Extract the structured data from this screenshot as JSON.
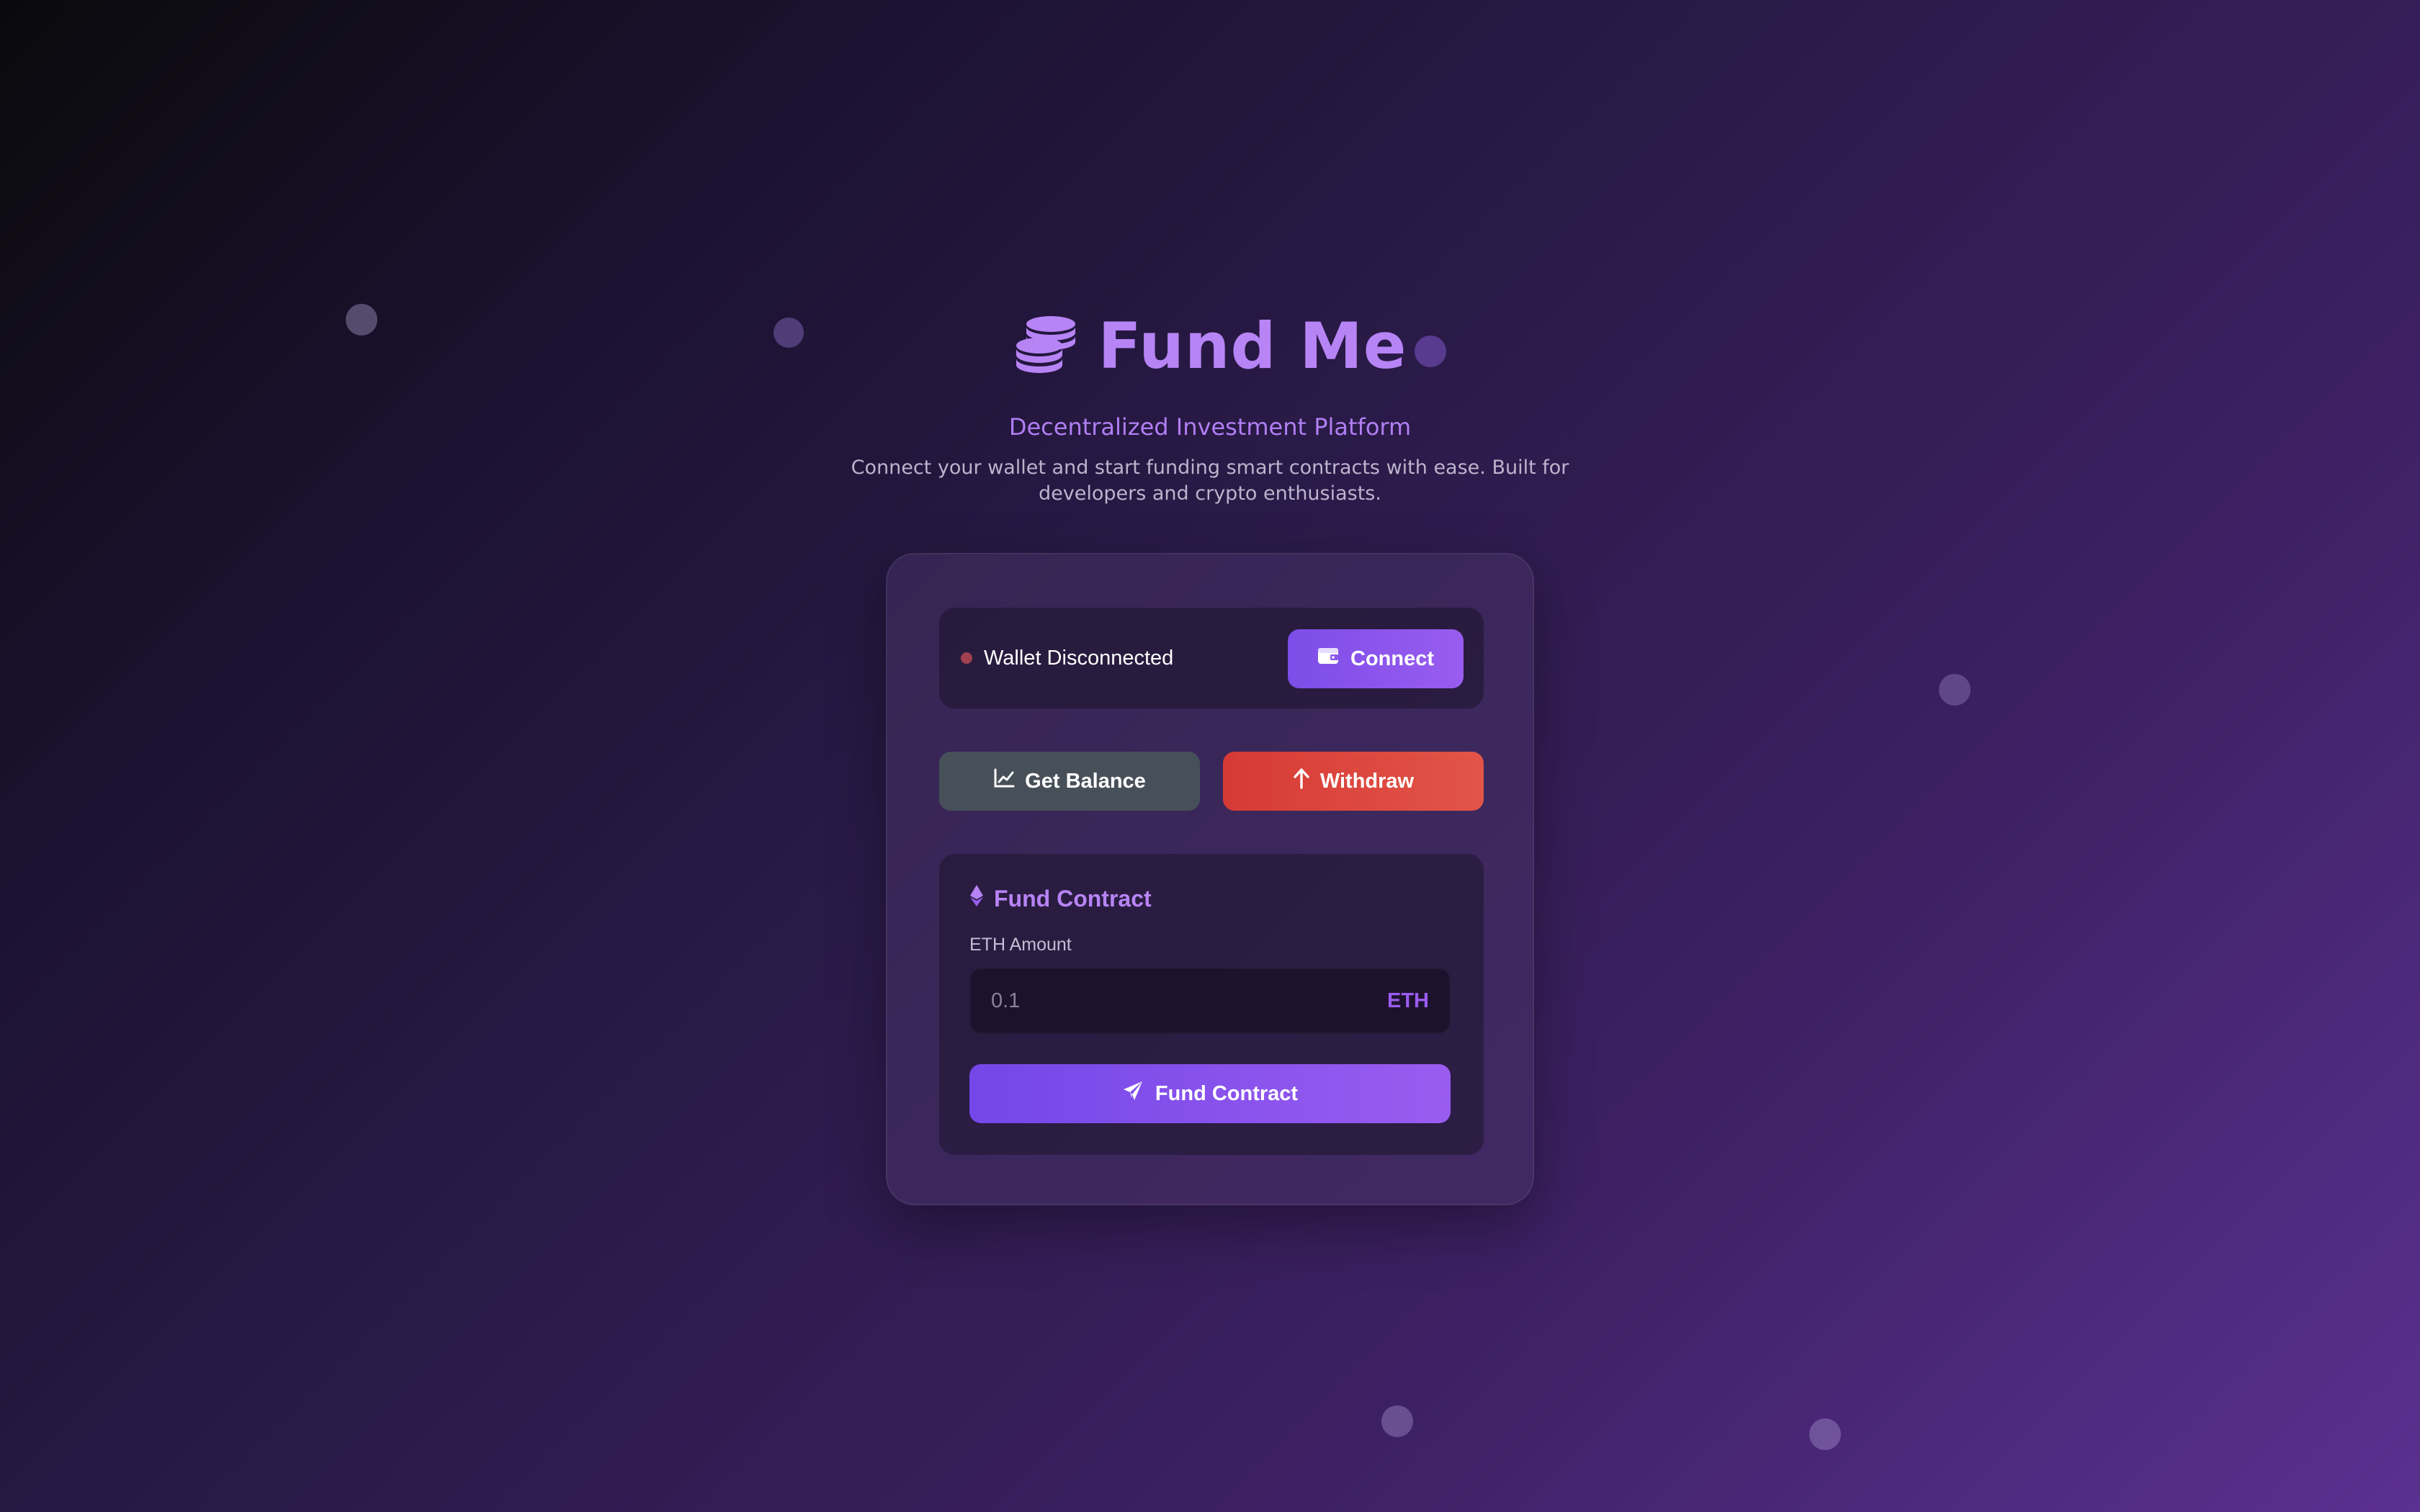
{
  "header": {
    "title": "Fund Me",
    "subtitle": "Decentralized Investment Platform",
    "description": "Connect your wallet and start funding smart contracts with ease. Built for developers and crypto enthusiasts."
  },
  "wallet": {
    "status": "Wallet Disconnected",
    "status_color": "#a04050",
    "connect_label": "Connect"
  },
  "actions": {
    "balance_label": "Get Balance",
    "withdraw_label": "Withdraw"
  },
  "fund": {
    "title": "Fund Contract",
    "amount_label": "ETH Amount",
    "amount_placeholder": "0.1",
    "unit": "ETH",
    "submit_label": "Fund Contract"
  },
  "icons": {
    "logo": "coins-icon",
    "wallet": "wallet-icon",
    "balance": "chart-line-icon",
    "withdraw": "arrow-up-icon",
    "ethereum": "ethereum-icon",
    "send": "paper-plane-icon"
  },
  "colors": {
    "accent": "#b784f5",
    "primary_button": "#7c4de8",
    "withdraw_button": "#d63a34",
    "balance_button": "#475059"
  }
}
